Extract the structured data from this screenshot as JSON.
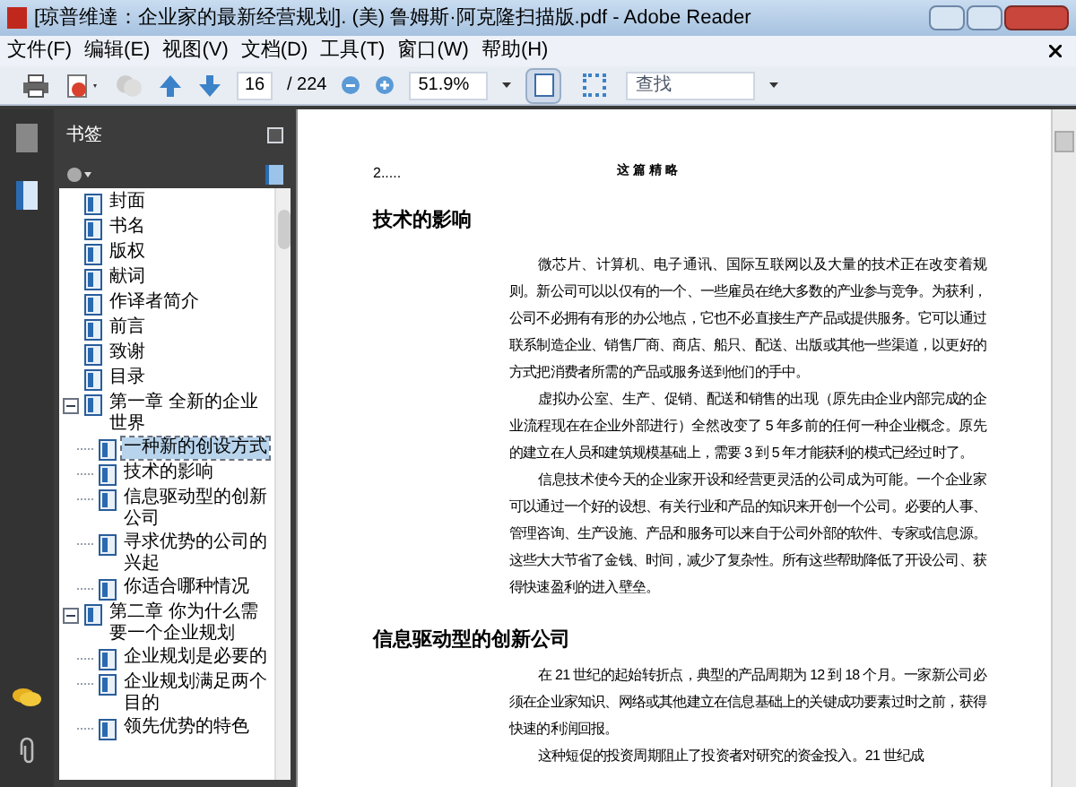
{
  "window": {
    "title": "[琼普维達：企业家的最新经营规划]. (美) 鲁姆斯·阿克隆扫描版.pdf - Adobe Reader"
  },
  "menu": [
    "文件(F)",
    "编辑(E)",
    "视图(V)",
    "文档(D)",
    "工具(T)",
    "窗口(W)",
    "帮助(H)"
  ],
  "toolbar": {
    "page": "16",
    "page_total": "/ 224",
    "zoom": "51.9%",
    "views": [
      {
        "selected": true
      },
      {
        "selected": false
      }
    ],
    "search": {
      "placeholder": "查找"
    }
  },
  "bookmarks": {
    "title": "书签",
    "items": [
      {
        "label": "封面",
        "selected": false
      },
      {
        "label": "书名",
        "selected": false
      },
      {
        "label": "版权",
        "selected": false
      },
      {
        "label": "献词",
        "selected": false
      },
      {
        "label": "作译者简介",
        "selected": false
      },
      {
        "label": "前言",
        "selected": false
      },
      {
        "label": "致谢",
        "selected": false
      },
      {
        "label": "目录",
        "selected": false
      },
      {
        "label": "第一章  全新的企业世界",
        "selected": false,
        "expanded": true,
        "children": [
          {
            "label": "一种新的创设方式",
            "selected": true
          },
          {
            "label": "技术的影响",
            "selected": false
          },
          {
            "label": "信息驱动型的创新公司",
            "selected": false
          },
          {
            "label": "寻求优势的公司的兴起",
            "selected": false
          },
          {
            "label": "你适合哪种情况",
            "selected": false
          }
        ]
      },
      {
        "label": "第二章  你为什么需要一个企业规划",
        "selected": false,
        "expanded": true,
        "children": [
          {
            "label": "企业规划是必要的",
            "selected": false
          },
          {
            "label": "企业规划满足两个目的",
            "selected": false
          },
          {
            "label": "领先优势的特色",
            "selected": false
          }
        ]
      }
    ]
  },
  "page": {
    "number": "2.....",
    "running_head": "这 篇 精 略",
    "blocks": [
      {
        "kind": "heading",
        "text": "技术的影响"
      },
      {
        "kind": "paragraph",
        "text": "微芯片、计算机、电子通讯、国际互联网以及大量的技术正在改变着规则。新公司可以以仅有的一个、一些雇员在绝大多数的产业参与竞争。为获利，公司不必拥有有形的办公地点，它也不必直接生产产品或提供服务。它可以通过联系制造企业、销售厂商、商店、船只、配送、出版或其他一些渠道，以更好的方式把消费者所需的产品或服务送到他们的手中。"
      },
      {
        "kind": "paragraph",
        "text": "虚拟办公室、生产、促销、配送和销售的出现（原先由企业内部完成的企业流程现在在企业外部进行）全然改变了 5 年多前的任何一种企业概念。原先的建立在人员和建筑规模基础上，需要 3 到 5 年才能获利的模式已经过时了。"
      },
      {
        "kind": "paragraph",
        "text": "信息技术使今天的企业家开设和经营更灵活的公司成为可能。一个企业家可以通过一个好的设想、有关行业和产品的知识来开创一个公司。必要的人事、管理咨询、生产设施、产品和服务可以来自于公司外部的软件、专家或信息源。这些大大节省了金钱、时间，减少了复杂性。所有这些帮助降低了开设公司、获得快速盈利的进入壁垒。"
      },
      {
        "kind": "heading",
        "text": "信息驱动型的创新公司"
      },
      {
        "kind": "paragraph",
        "text": "在 21 世纪的起始转折点，典型的产品周期为 12 到 18 个月。一家新公司必须在企业家知识、网络或其他建立在信息基础上的关键成功要素过时之前，获得快速的利润回报。"
      },
      {
        "kind": "paragraph",
        "text": "这种短促的投资周期阻止了投资者对研究的资金投入。21 世纪成"
      }
    ]
  }
}
